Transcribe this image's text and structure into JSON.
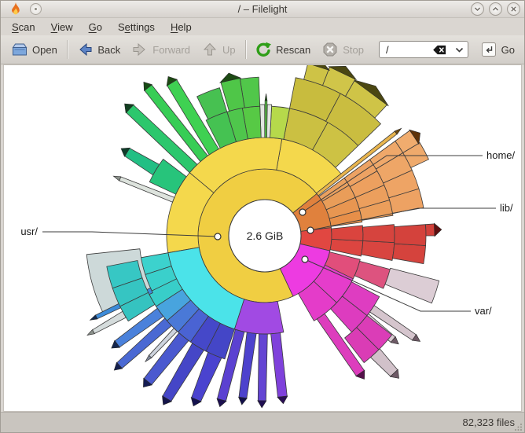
{
  "window": {
    "title": "/ – Filelight"
  },
  "menu": {
    "items": [
      {
        "pre": "",
        "u": "S",
        "rest": "can"
      },
      {
        "pre": "",
        "u": "V",
        "rest": "iew"
      },
      {
        "pre": "",
        "u": "G",
        "rest": "o"
      },
      {
        "pre": "S",
        "u": "e",
        "rest": "ttings"
      },
      {
        "pre": "",
        "u": "H",
        "rest": "elp"
      }
    ]
  },
  "toolbar": {
    "open": "Open",
    "back": "Back",
    "forward": "Forward",
    "up": "Up",
    "rescan": "Rescan",
    "stop": "Stop",
    "go": "Go",
    "address_value": "/"
  },
  "status": {
    "files": "82,323 files"
  },
  "chart": {
    "type": "radial-filelight-map",
    "center_label": "2.6 GiB",
    "labels": {
      "usr": "usr/",
      "home": "home/",
      "lib": "lib/",
      "var": "var/"
    },
    "ring_radii": [
      46,
      85,
      125,
      165,
      205,
      245
    ],
    "segments": [
      [
        39,
        295,
        46,
        85,
        "#f0ce42"
      ],
      [
        7,
        39,
        46,
        85,
        "#e0813d"
      ],
      [
        -13,
        7,
        46,
        85,
        "#e14741"
      ],
      [
        -65,
        -13,
        46,
        85,
        "#ed3be1"
      ],
      [
        39,
        80,
        85,
        125,
        "#f4d84c"
      ],
      [
        80,
        140,
        85,
        125,
        "#f4d84c"
      ],
      [
        140,
        190,
        85,
        125,
        "#f4d84c"
      ],
      [
        190,
        252,
        85,
        125,
        "#4be3e9"
      ],
      [
        252,
        281,
        85,
        125,
        "#a14ae3"
      ],
      [
        8,
        15,
        85,
        125,
        "#e78f49"
      ],
      [
        15,
        23,
        85,
        125,
        "#e89651"
      ],
      [
        23,
        31,
        85,
        125,
        "#e99d59"
      ],
      [
        31,
        36,
        85,
        125,
        "#eaa160"
      ],
      [
        36.8,
        39.6,
        85,
        212,
        "#e8b44d",
        0.45,
        "#6e4a10"
      ],
      [
        -12,
        -3,
        85,
        125,
        "#dc4540"
      ],
      [
        -3,
        6,
        85,
        125,
        "#da443e"
      ],
      [
        -26,
        -14,
        85,
        125,
        "#e14e7b"
      ],
      [
        -43,
        -26,
        85,
        125,
        "#e53dcb"
      ],
      [
        -60,
        -43,
        85,
        125,
        "#e43cc9"
      ],
      [
        9,
        16,
        125,
        165,
        "#eb9e5b"
      ],
      [
        16,
        23,
        125,
        165,
        "#ec9f5d"
      ],
      [
        23,
        30,
        125,
        165,
        "#eda05f"
      ],
      [
        30,
        36,
        125,
        165,
        "#eda263"
      ],
      [
        44,
        61,
        125,
        165,
        "#cdc244"
      ],
      [
        61,
        79,
        125,
        165,
        "#cbc042"
      ],
      [
        79,
        87,
        125,
        165,
        "#b6d94b"
      ],
      [
        87,
        88.9,
        125,
        167,
        "#e2e6e1"
      ],
      [
        88.9,
        90.1,
        125,
        172,
        "#58cd43",
        0.7,
        "#1d4a14"
      ],
      [
        90.1,
        92.2,
        125,
        167,
        "#e2e6e1"
      ],
      [
        92.2,
        100,
        125,
        165,
        "#57c945"
      ],
      [
        100,
        107,
        125,
        165,
        "#4fc64c"
      ],
      [
        107,
        117,
        125,
        165,
        "#45c252"
      ],
      [
        118,
        124.5,
        125,
        228,
        "#3fd152",
        0.55,
        "#1d4a14"
      ],
      [
        125.5,
        131,
        125,
        240,
        "#37cd55",
        0.5,
        "#174a14"
      ],
      [
        133.5,
        140,
        125,
        236,
        "#2cc76d",
        0.5,
        "#123f20"
      ],
      [
        143,
        155,
        125,
        162,
        "#27c47b"
      ],
      [
        146,
        151.5,
        162,
        205,
        "#22bf84",
        0.6,
        "#0f3d2a"
      ],
      [
        157,
        160,
        125,
        198,
        "#dde3dd",
        0.5,
        "#8a908a"
      ],
      [
        190,
        198,
        125,
        165,
        "#3cd2cd"
      ],
      [
        198,
        206,
        125,
        165,
        "#3ad0cb"
      ],
      [
        206,
        213,
        125,
        165,
        "#38cec9"
      ],
      [
        213,
        221,
        125,
        165,
        "#48a4de"
      ],
      [
        221,
        228,
        125,
        165,
        "#4a79d7"
      ],
      [
        228,
        235,
        125,
        165,
        "#4a63d3"
      ],
      [
        235,
        243,
        125,
        165,
        "#4548c9"
      ],
      [
        243,
        252,
        125,
        165,
        "#4446c7"
      ],
      [
        -11,
        -3,
        125,
        165,
        "#d84540"
      ],
      [
        -3,
        5,
        125,
        165,
        "#d6443e"
      ],
      [
        -24,
        -15,
        125,
        165,
        "#dd537f"
      ],
      [
        -38,
        -28,
        125,
        165,
        "#de3dc1"
      ],
      [
        -48,
        -38,
        125,
        165,
        "#dd3cbf"
      ],
      [
        10,
        17,
        165,
        205,
        "#eda263"
      ],
      [
        17,
        24,
        165,
        205,
        "#eea465"
      ],
      [
        24,
        31,
        165,
        205,
        "#eea667"
      ],
      [
        31,
        36,
        165,
        205,
        "#efa86a"
      ],
      [
        25,
        31,
        205,
        230,
        "#efaa6c"
      ],
      [
        31,
        36,
        205,
        228,
        "#f0ac6e",
        1,
        "#5e3208"
      ],
      [
        44,
        62,
        165,
        205,
        "#cabd40"
      ],
      [
        62,
        79,
        165,
        205,
        "#c8bc3e"
      ],
      [
        47,
        60,
        205,
        228,
        "#cfc447",
        1,
        "#4b4712"
      ],
      [
        60,
        69,
        205,
        230,
        "#d0c549",
        1,
        "#4b4712"
      ],
      [
        69,
        76,
        205,
        226,
        "#cec346",
        1,
        "#4b4712"
      ],
      [
        92.2,
        99,
        165,
        202,
        "#51c74a"
      ],
      [
        99,
        106,
        165,
        203,
        "#4fc648",
        1,
        "#1d4a14"
      ],
      [
        107,
        116,
        165,
        197,
        "#47c151"
      ],
      [
        186,
        206,
        160,
        228,
        "#cdd9d9"
      ],
      [
        204.5,
        207,
        160,
        238,
        "#3d8bd9",
        0.5,
        "#122a50"
      ],
      [
        208,
        210.5,
        205,
        250,
        "#d5dcdc",
        0.5,
        "#8a908a"
      ],
      [
        191,
        199,
        165,
        205,
        "#37c7c4"
      ],
      [
        199,
        206,
        165,
        205,
        "#36c5c2"
      ],
      [
        206,
        212,
        165,
        205,
        "#35c3c0"
      ],
      [
        214,
        218.5,
        165,
        233,
        "#4a81db",
        0.55,
        "#14264e"
      ],
      [
        219.5,
        224,
        165,
        248,
        "#4a69d3",
        0.5,
        "#14204e"
      ],
      [
        225.5,
        227.5,
        165,
        212,
        "#cdd3dd",
        0.6,
        "#80889a"
      ],
      [
        228.5,
        234,
        165,
        238,
        "#4a59cf",
        0.55,
        "#141c52"
      ],
      [
        236,
        242,
        165,
        242,
        "#4546c7",
        0.5,
        "#15154a"
      ],
      [
        244,
        250.5,
        165,
        226,
        "#4a43cf",
        0.5,
        "#14124e"
      ],
      [
        252.5,
        258,
        125,
        216,
        "#5b41d1",
        0.55,
        "#1c1050"
      ],
      [
        259.5,
        265,
        125,
        208,
        "#4d42cd",
        0.5,
        "#120f4a"
      ],
      [
        266.5,
        271.5,
        125,
        210,
        "#6344d3",
        0.55,
        "#200f52"
      ],
      [
        273.5,
        279,
        125,
        206,
        "#7f41db",
        0.6,
        "#2a0e55"
      ],
      [
        -10,
        -3.5,
        165,
        205,
        "#d5433d"
      ],
      [
        -3.5,
        4,
        165,
        205,
        "#d4423c"
      ],
      [
        0,
        4,
        205,
        216,
        "#d2403a",
        1,
        "#5e0f0f"
      ],
      [
        -22,
        -14.5,
        165,
        229,
        "#dccdd5"
      ],
      [
        -36,
        -32.5,
        165,
        230,
        "#d5c5cd",
        0.6,
        "#6e5a66"
      ],
      [
        -41,
        -37,
        165,
        210,
        "#d9c9d1",
        0.6,
        "#6e5a66"
      ],
      [
        -45,
        -38,
        165,
        205,
        "#db3db7"
      ],
      [
        -52,
        -45,
        165,
        205,
        "#da3cb5"
      ],
      [
        -58,
        -52.5,
        125,
        213,
        "#dd3dbd",
        0.6,
        "#55104a"
      ],
      [
        -49,
        -44.5,
        205,
        240,
        "#d1c1c9",
        0.65,
        "#6e5a66"
      ]
    ]
  }
}
